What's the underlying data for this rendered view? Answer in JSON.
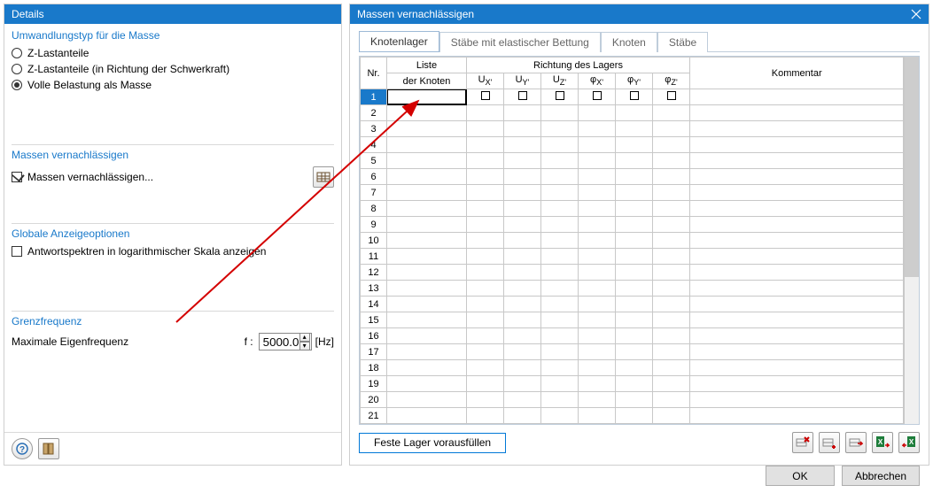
{
  "left": {
    "title": "Details",
    "group1": {
      "title": "Umwandlungstyp für die Masse",
      "opt1": "Z-Lastanteile",
      "opt2": "Z-Lastanteile (in Richtung der Schwerkraft)",
      "opt3": "Volle Belastung als Masse"
    },
    "group2": {
      "title": "Massen vernachlässigen",
      "chk": "Massen vernachlässigen..."
    },
    "group3": {
      "title": "Globale Anzeigeoptionen",
      "chk": "Antwortspektren in logarithmischer Skala anzeigen"
    },
    "group4": {
      "title": "Grenzfrequenz",
      "label": "Maximale Eigenfrequenz",
      "f": "f :",
      "value": "5000.0",
      "unit": "[Hz]"
    }
  },
  "right": {
    "title": "Massen vernachlässigen",
    "tabs": {
      "t1": "Knotenlager",
      "t2": "Stäbe mit elastischer Bettung",
      "t3": "Knoten",
      "t4": "Stäbe"
    },
    "headers": {
      "nr": "Nr.",
      "liste": "Liste",
      "liste2": "der Knoten",
      "richtung": "Richtung des Lagers",
      "ux": "Uₓ'",
      "uy": "Uᵧ'",
      "uz": "U_Z'",
      "px": "φₓ'",
      "py": "φᵧ'",
      "pz": "φ_Z'",
      "komm": "Kommentar"
    },
    "rows_count": 21,
    "btn_prefill": "Feste Lager vorausfüllen",
    "btn_ok": "OK",
    "btn_cancel": "Abbrechen"
  }
}
